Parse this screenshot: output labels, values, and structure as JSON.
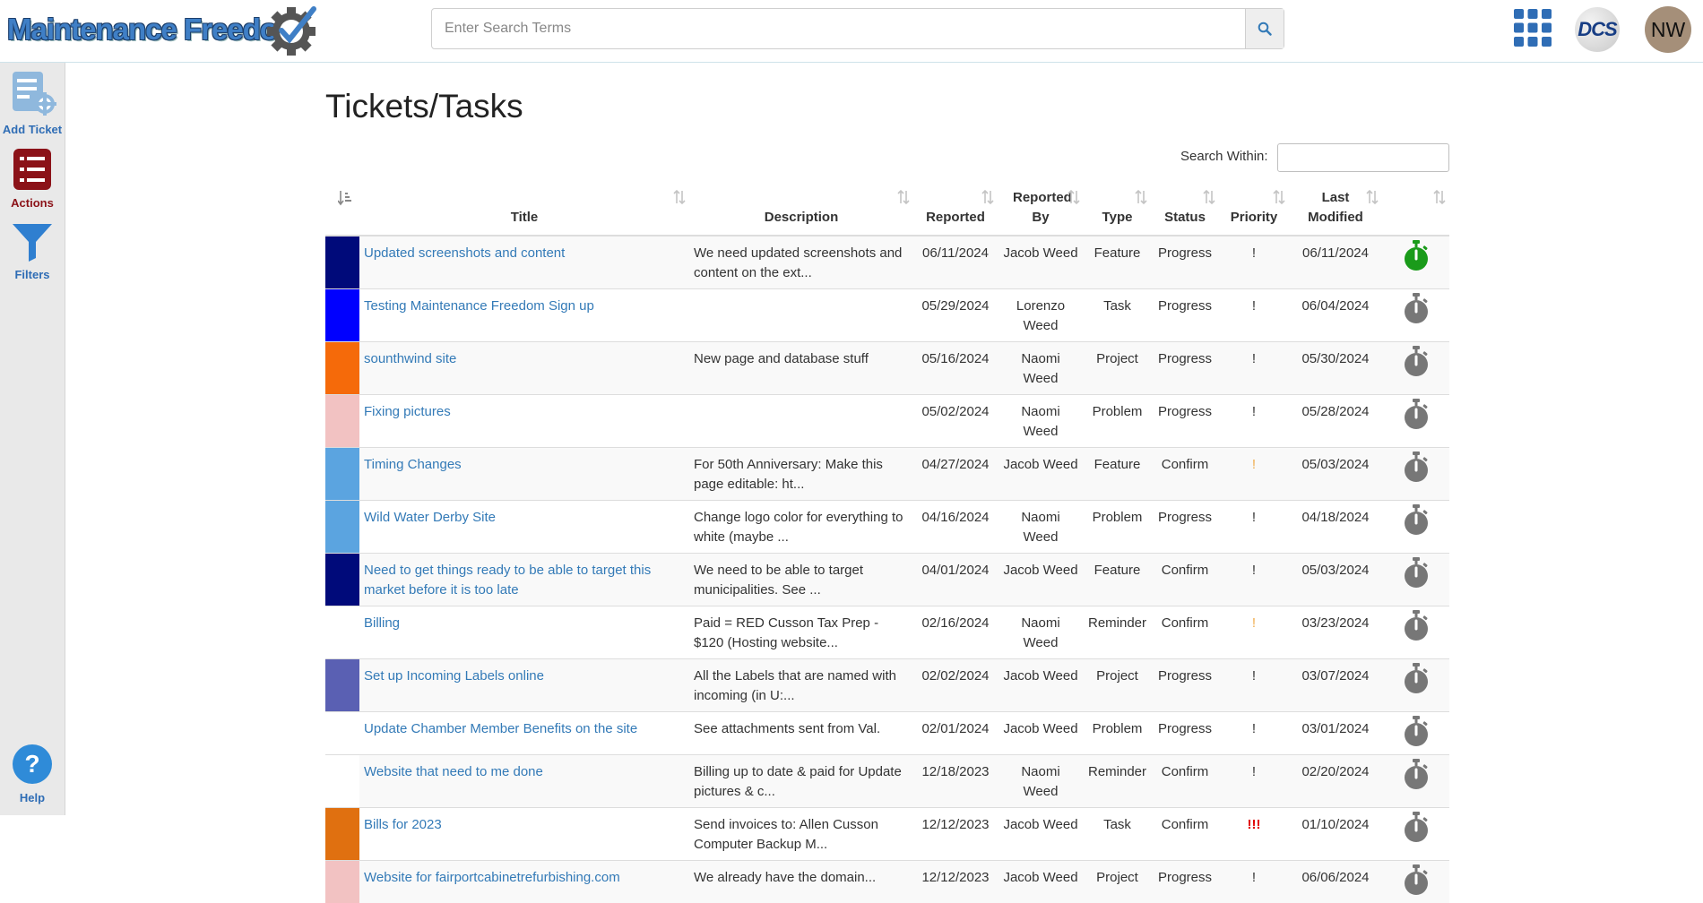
{
  "header": {
    "logo_text": "Maintenance Freedom",
    "search_placeholder": "Enter Search Terms",
    "company_badge": "DCS",
    "user_initials": "NW"
  },
  "sidebar": {
    "items": [
      {
        "label": "Add Ticket",
        "icon": "add-ticket-icon"
      },
      {
        "label": "Actions",
        "icon": "actions-list-icon"
      },
      {
        "label": "Filters",
        "icon": "filter-funnel-icon"
      },
      {
        "label": "Help",
        "icon": "help-icon"
      }
    ]
  },
  "page": {
    "title": "Tickets/Tasks",
    "search_within_label": "Search Within:"
  },
  "table": {
    "columns": [
      {
        "key": "color",
        "label": ""
      },
      {
        "key": "title",
        "label": "Title"
      },
      {
        "key": "description",
        "label": "Description"
      },
      {
        "key": "reported",
        "label": "Reported"
      },
      {
        "key": "reported_by",
        "label": "Reported By"
      },
      {
        "key": "type",
        "label": "Type"
      },
      {
        "key": "status",
        "label": "Status"
      },
      {
        "key": "priority",
        "label": "Priority"
      },
      {
        "key": "last_modified",
        "label": "Last Modified"
      },
      {
        "key": "timer",
        "label": ""
      }
    ],
    "rows": [
      {
        "color": "#000a7a",
        "title": "Updated screenshots and content",
        "description": "We need updated screenshots and content on the ext...",
        "reported": "06/11/2024",
        "reported_by": "Jacob Weed",
        "type": "Feature",
        "status": "Progress",
        "priority": "!",
        "priority_level": "normal",
        "last_modified": "06/11/2024",
        "timer_active": true
      },
      {
        "color": "#0000ff",
        "title": "Testing Maintenance Freedom Sign up",
        "description": "",
        "reported": "05/29/2024",
        "reported_by": "Lorenzo Weed",
        "type": "Task",
        "status": "Progress",
        "priority": "!",
        "priority_level": "normal",
        "last_modified": "06/04/2024",
        "timer_active": false
      },
      {
        "color": "#f56a0a",
        "title": "sounthwind site",
        "description": "New page and database stuff",
        "reported": "05/16/2024",
        "reported_by": "Naomi Weed",
        "type": "Project",
        "status": "Progress",
        "priority": "!",
        "priority_level": "normal",
        "last_modified": "05/30/2024",
        "timer_active": false
      },
      {
        "color": "#f2c2c2",
        "title": "Fixing pictures",
        "description": "",
        "reported": "05/02/2024",
        "reported_by": "Naomi Weed",
        "type": "Problem",
        "status": "Progress",
        "priority": "!",
        "priority_level": "normal",
        "last_modified": "05/28/2024",
        "timer_active": false
      },
      {
        "color": "#5ba4e0",
        "title": "Timing Changes",
        "description": "For 50th Anniversary: Make this page editable: ht...",
        "reported": "04/27/2024",
        "reported_by": "Jacob Weed",
        "type": "Feature",
        "status": "Confirm",
        "priority": "!",
        "priority_level": "warn",
        "last_modified": "05/03/2024",
        "timer_active": false
      },
      {
        "color": "#5ba4e0",
        "title": "Wild Water Derby Site",
        "description": "Change logo color for everything to white (maybe ...",
        "reported": "04/16/2024",
        "reported_by": "Naomi Weed",
        "type": "Problem",
        "status": "Progress",
        "priority": "!",
        "priority_level": "normal",
        "last_modified": "04/18/2024",
        "timer_active": false
      },
      {
        "color": "#000a7a",
        "title": "Need to get things ready to be able to target this market before it is too late",
        "description": "We need to be able to target municipalities. See ...",
        "reported": "04/01/2024",
        "reported_by": "Jacob Weed",
        "type": "Feature",
        "status": "Confirm",
        "priority": "!",
        "priority_level": "normal",
        "last_modified": "05/03/2024",
        "timer_active": false
      },
      {
        "color": "",
        "title": "Billing",
        "description": "Paid = RED Cusson Tax Prep - $120 (Hosting website...",
        "reported": "02/16/2024",
        "reported_by": "Naomi Weed",
        "type": "Reminder",
        "status": "Confirm",
        "priority": "!",
        "priority_level": "warn",
        "last_modified": "03/23/2024",
        "timer_active": false
      },
      {
        "color": "#5a60b3",
        "title": "Set up Incoming Labels online",
        "description": "All the Labels that are named with incoming (in U:...",
        "reported": "02/02/2024",
        "reported_by": "Jacob Weed",
        "type": "Project",
        "status": "Progress",
        "priority": "!",
        "priority_level": "normal",
        "last_modified": "03/07/2024",
        "timer_active": false
      },
      {
        "color": "",
        "title": "Update Chamber Member Benefits on the site",
        "description": "See attachments sent from Val.",
        "reported": "02/01/2024",
        "reported_by": "Jacob Weed",
        "type": "Problem",
        "status": "Progress",
        "priority": "!",
        "priority_level": "normal",
        "last_modified": "03/01/2024",
        "timer_active": false
      },
      {
        "color": "",
        "title": "Website that need to me done",
        "description": "Billing up to date & paid for Update pictures & c...",
        "reported": "12/18/2023",
        "reported_by": "Naomi Weed",
        "type": "Reminder",
        "status": "Confirm",
        "priority": "!",
        "priority_level": "normal",
        "last_modified": "02/20/2024",
        "timer_active": false
      },
      {
        "color": "#e07010",
        "title": "Bills for 2023",
        "description": "Send invoices to: Allen Cusson Computer Backup M...",
        "reported": "12/12/2023",
        "reported_by": "Jacob Weed",
        "type": "Task",
        "status": "Confirm",
        "priority": "!!!",
        "priority_level": "high",
        "last_modified": "01/10/2024",
        "timer_active": false
      },
      {
        "color": "#f2c2c2",
        "title": "Website for fairportcabinetrefurbishing.com",
        "description": "We already have the domain...",
        "reported": "12/12/2023",
        "reported_by": "Jacob Weed",
        "type": "Project",
        "status": "Progress",
        "priority": "!",
        "priority_level": "normal",
        "last_modified": "06/06/2024",
        "timer_active": false
      }
    ]
  }
}
